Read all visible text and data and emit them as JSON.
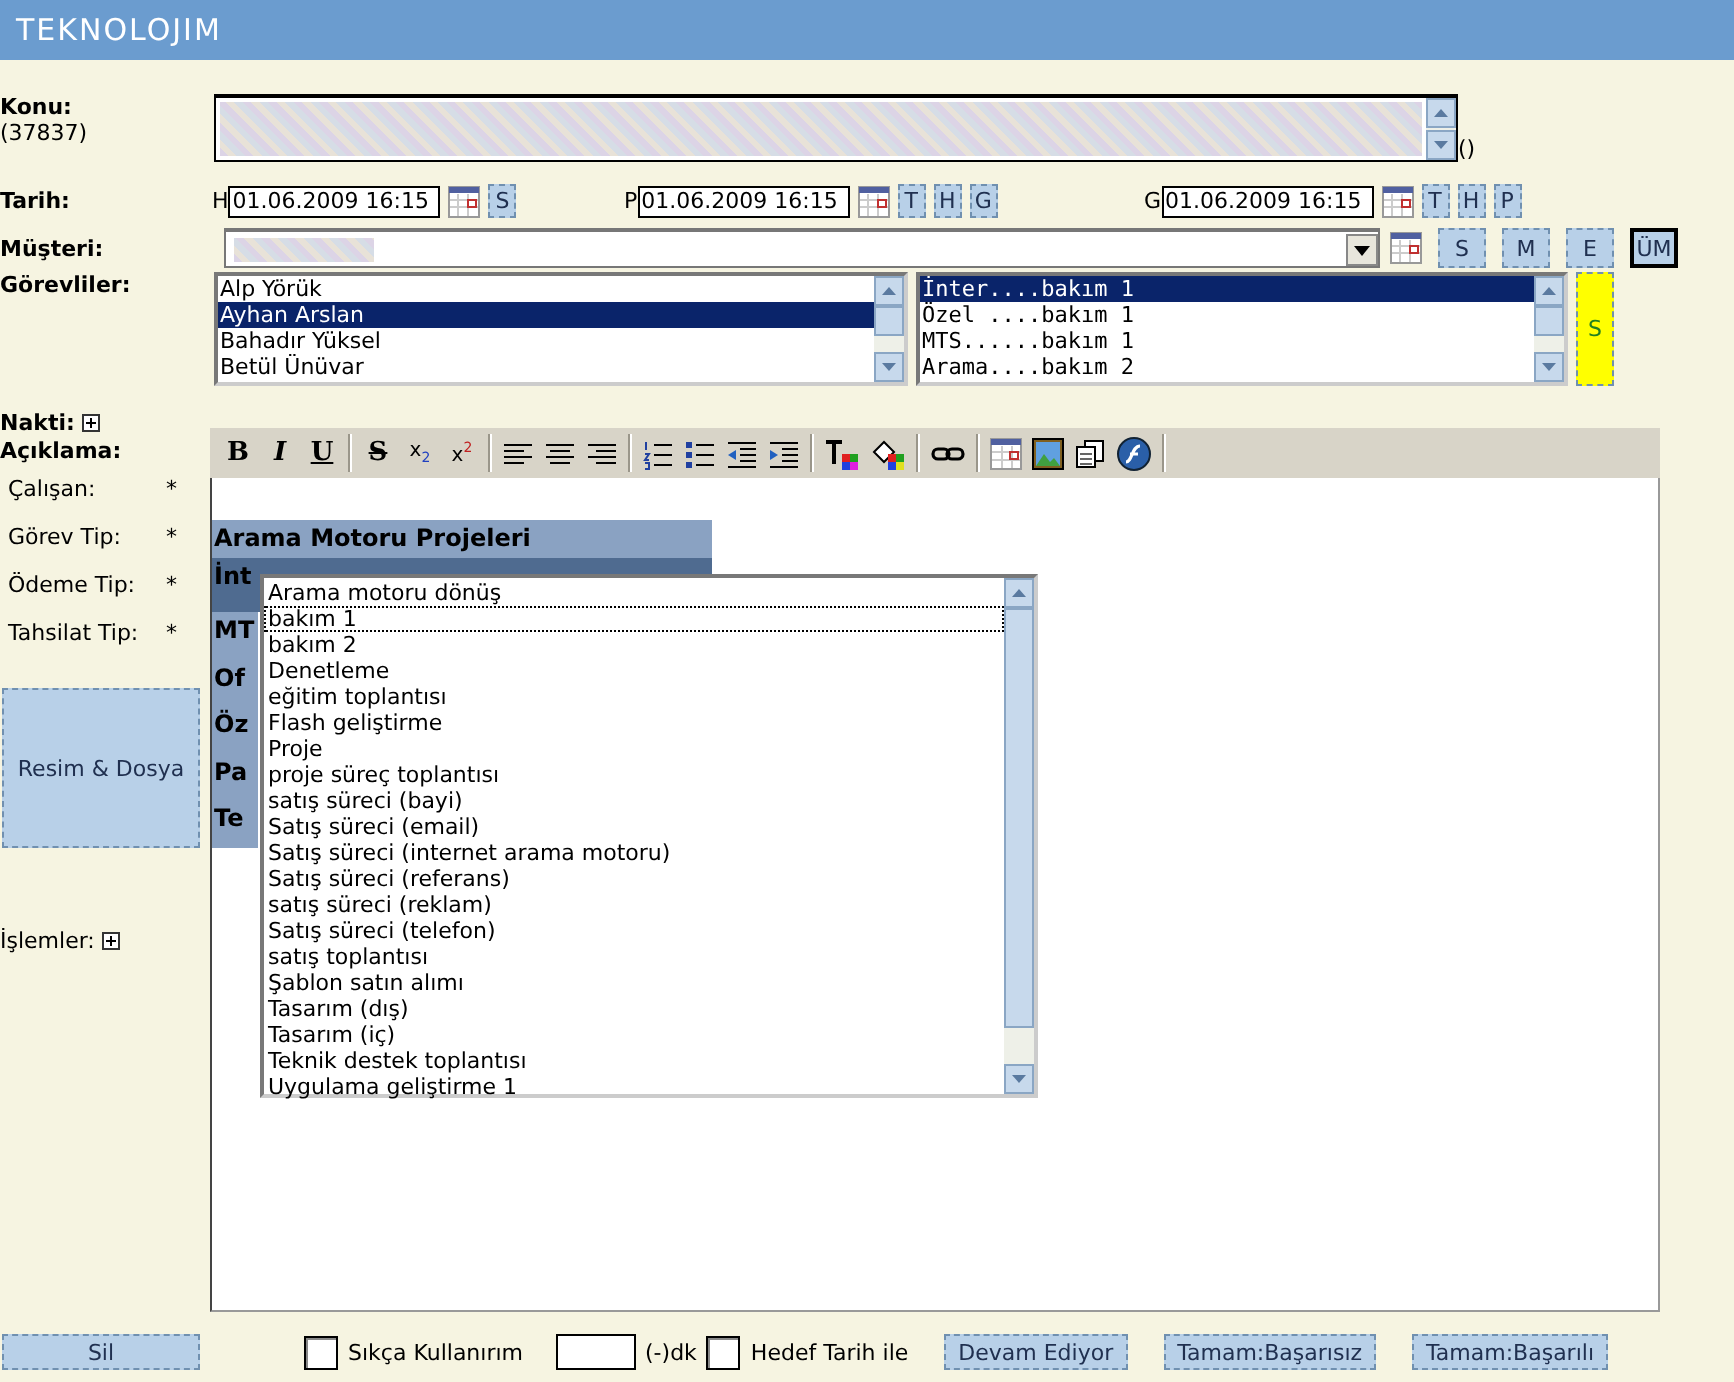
{
  "header": {
    "logo": "TEKNOLOJIM"
  },
  "subject": {
    "label": "Konu:",
    "id": "(37837)",
    "suffix": "()"
  },
  "dates": {
    "label": "Tarih:",
    "groups": [
      {
        "prefix": "H",
        "value": "01.06.2009 16:15",
        "buttons": [
          "S"
        ]
      },
      {
        "prefix": "P",
        "value": "01.06.2009 16:15",
        "buttons": [
          "T",
          "H",
          "G"
        ]
      },
      {
        "prefix": "G",
        "value": "01.06.2009 16:15",
        "buttons": [
          "T",
          "H",
          "P"
        ]
      }
    ]
  },
  "customer": {
    "label": "Müşteri:",
    "buttons": [
      {
        "label": "S",
        "selected": false
      },
      {
        "label": "M",
        "selected": false
      },
      {
        "label": "E",
        "selected": false
      },
      {
        "label": "ÜM",
        "selected": true
      }
    ]
  },
  "assignees": {
    "label": "Görevliler:",
    "people": [
      {
        "name": "Alp Yörük",
        "selected": false
      },
      {
        "name": "Ayhan Arslan",
        "selected": true
      },
      {
        "name": "Bahadır Yüksel",
        "selected": false
      },
      {
        "name": "Betül Ünüvar",
        "selected": false
      }
    ],
    "tasks": [
      {
        "name": "İnter....bakım 1",
        "selected": true
      },
      {
        "name": "Özel ....bakım 1",
        "selected": false
      },
      {
        "name": "MTS......bakım 1",
        "selected": false
      },
      {
        "name": "Arama....bakım 2",
        "selected": false
      }
    ],
    "side_button": "S"
  },
  "left_labels": {
    "cash": "Nakti:",
    "description": "Açıklama:",
    "fields": [
      {
        "label": "Çalışan:",
        "required": "*"
      },
      {
        "label": "Görev Tip:",
        "required": "*"
      },
      {
        "label": "Ödeme Tip:",
        "required": "*"
      },
      {
        "label": "Tahsilat Tip:",
        "required": "*"
      }
    ],
    "files_button": "Resim & Dosya",
    "operations": "İşlemler:"
  },
  "editor": {
    "format_buttons": [
      "B",
      "I",
      "U"
    ],
    "script_buttons": [
      "S",
      "x$_{2}$",
      "x$^{2}$"
    ]
  },
  "group_menu": [
    {
      "label": "Arama Motoru Projeleri",
      "selected": false
    },
    {
      "label": "İnt",
      "selected": true
    },
    {
      "label": "MT",
      "selected": false
    },
    {
      "label": "Of",
      "selected": false
    },
    {
      "label": "Öz",
      "selected": false
    },
    {
      "label": "Pa",
      "selected": false
    },
    {
      "label": "Te",
      "selected": false
    }
  ],
  "task_list": [
    {
      "label": "Arama motoru dönüş",
      "focused": false
    },
    {
      "label": "bakım 1",
      "focused": true
    },
    {
      "label": "bakım 2",
      "focused": false
    },
    {
      "label": "Denetleme",
      "focused": false
    },
    {
      "label": "eğitim toplantısı",
      "focused": false
    },
    {
      "label": "Flash geliştirme",
      "focused": false
    },
    {
      "label": "Proje",
      "focused": false
    },
    {
      "label": "proje süreç toplantısı",
      "focused": false
    },
    {
      "label": "satış süreci (bayi)",
      "focused": false
    },
    {
      "label": "Satış süreci (email)",
      "focused": false
    },
    {
      "label": "Satış süreci (internet arama motoru)",
      "focused": false
    },
    {
      "label": "Satış süreci (referans)",
      "focused": false
    },
    {
      "label": "satış süreci (reklam)",
      "focused": false
    },
    {
      "label": "Satış süreci (telefon)",
      "focused": false
    },
    {
      "label": "satış toplantısı",
      "focused": false
    },
    {
      "label": "Şablon satın alımı",
      "focused": false
    },
    {
      "label": "Tasarım (dış)",
      "focused": false
    },
    {
      "label": "Tasarım (iç)",
      "focused": false
    },
    {
      "label": "Teknik destek toplantısı",
      "focused": false
    },
    {
      "label": "Uygulama geliştirme 1",
      "focused": false
    }
  ],
  "footer": {
    "delete": "Sil",
    "frequent": {
      "label": "Sıkça Kullanırım",
      "checked": false
    },
    "minutes_suffix": "(-)dk",
    "target": {
      "label": "Hedef Tarih ile",
      "checked": false
    },
    "actions": [
      "Devam Ediyor",
      "Tamam:Başarısız",
      "Tamam:Başarılı"
    ]
  }
}
